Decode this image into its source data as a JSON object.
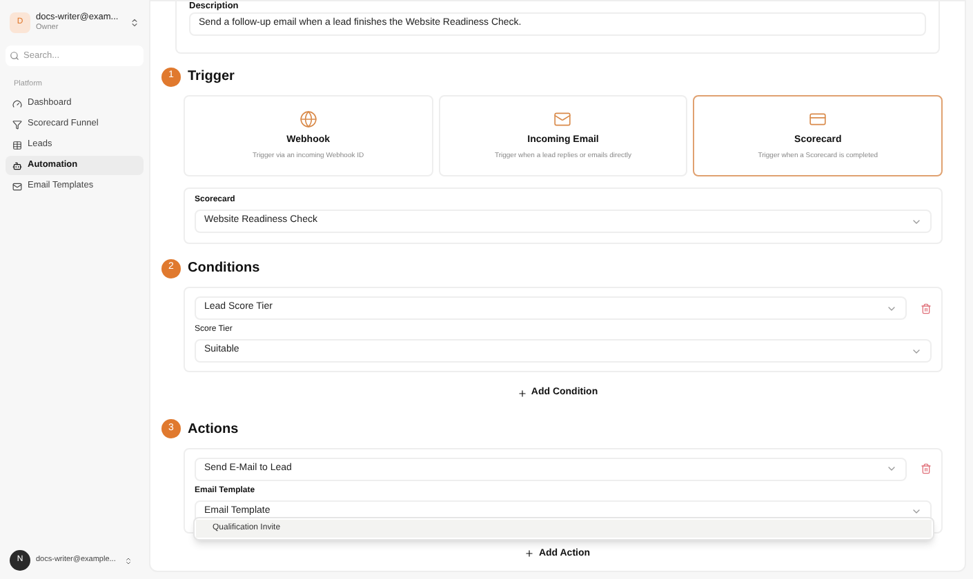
{
  "sidebar": {
    "account": {
      "avatar": "D",
      "name": "docs-writer@exam...",
      "role": "Owner"
    },
    "search": {
      "placeholder": "Search..."
    },
    "section": "Platform",
    "items": [
      {
        "label": "Dashboard",
        "selected": false
      },
      {
        "label": "Scorecard Funnel",
        "selected": false
      },
      {
        "label": "Leads",
        "selected": false
      },
      {
        "label": "Automation",
        "selected": true
      },
      {
        "label": "Email Templates",
        "selected": false
      }
    ],
    "user": {
      "avatar": "N",
      "name": "docs-writer@example..."
    }
  },
  "description": {
    "label": "Description",
    "value": "Send a follow-up email when a lead finishes the Website Readiness Check."
  },
  "trigger": {
    "number": "1",
    "title": "Trigger",
    "options": [
      {
        "title": "Webhook",
        "subtitle": "Trigger via an incoming Webhook ID",
        "selected": false
      },
      {
        "title": "Incoming Email",
        "subtitle": "Trigger when a lead replies or emails directly",
        "selected": false
      },
      {
        "title": "Scorecard",
        "subtitle": "Trigger when a Scorecard is completed",
        "selected": true
      }
    ],
    "scorecard": {
      "label": "Scorecard",
      "value": "Website Readiness Check"
    }
  },
  "conditions": {
    "number": "2",
    "title": "Conditions",
    "items": [
      {
        "type": "Lead Score Tier",
        "field_label": "Score Tier",
        "field_value": "Suitable"
      }
    ],
    "add": "Add Condition"
  },
  "actions": {
    "number": "3",
    "title": "Actions",
    "items": [
      {
        "type": "Send E-Mail to Lead",
        "field_label": "Email Template",
        "field_value": "Email Template"
      }
    ],
    "menu": [
      "Qualification Invite"
    ],
    "add": "Add Action"
  }
}
